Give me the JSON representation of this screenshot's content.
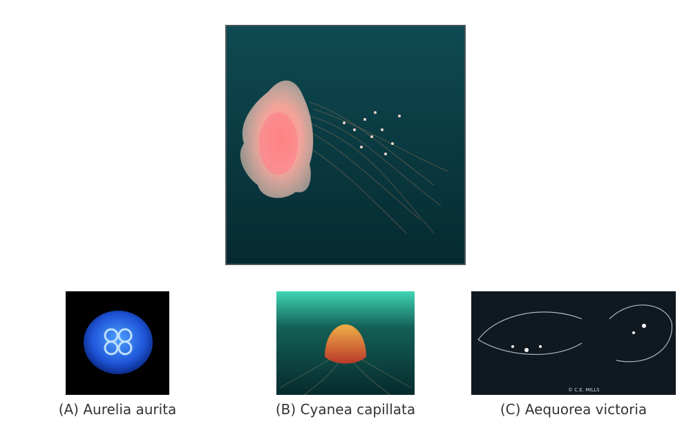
{
  "main_photo": {
    "description_icon": "jellyfish-photo-icon"
  },
  "figures": [
    {
      "id": "a",
      "caption": "(A) Aurelia aurita"
    },
    {
      "id": "b",
      "caption": "(B) Cyanea capillata"
    },
    {
      "id": "c",
      "caption": "(C) Aequorea victoria",
      "credit": "© C.E. MILLS"
    }
  ],
  "colors": {
    "deep_sea": "#0c3b44",
    "jelly_pink": "#f2a0a0",
    "moon_blue": "#2a7cff",
    "lion_orange": "#e0842a"
  }
}
